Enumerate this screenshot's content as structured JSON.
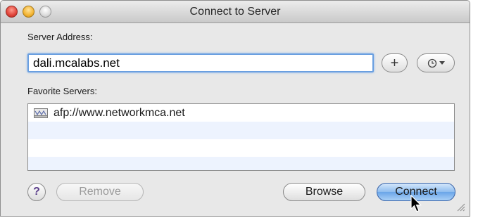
{
  "window": {
    "title": "Connect to Server"
  },
  "server_address": {
    "label": "Server Address:",
    "value": "dali.mcalabs.net"
  },
  "buttons": {
    "add_symbol": "+",
    "recent_symbol": "◷",
    "remove": "Remove",
    "browse": "Browse",
    "connect": "Connect",
    "help": "?"
  },
  "favorites": {
    "label": "Favorite Servers:",
    "items": [
      "afp://www.networkmca.net"
    ]
  },
  "colors": {
    "focus_ring": "#6a9fe0",
    "primary_button": "#6aa5e8"
  },
  "icons": [
    "close-icon",
    "minimize-icon",
    "zoom-icon",
    "plus-icon",
    "clock-icon",
    "chevron-down-icon",
    "server-icon",
    "help-icon",
    "resize-grip-icon",
    "cursor-icon"
  ]
}
